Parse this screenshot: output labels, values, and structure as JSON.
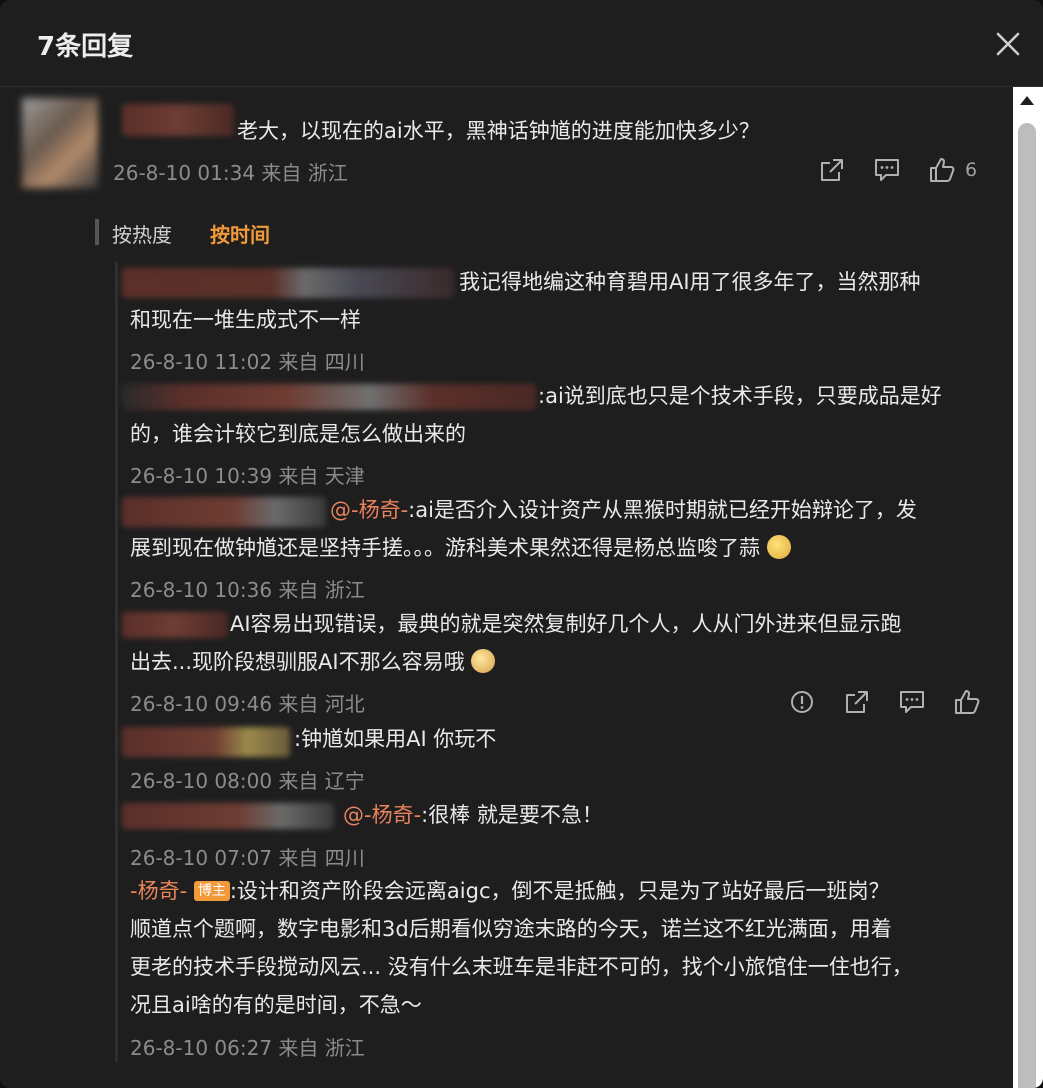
{
  "header": {
    "title": "7条回复"
  },
  "main_comment": {
    "text": "老大，以现在的ai水平，黑神话钟馗的进度能加快多少？",
    "time": "26-8-10 01:34",
    "location": "来自 浙江",
    "like_count": "6"
  },
  "sort": {
    "by_hot": "按热度",
    "by_time": "按时间"
  },
  "replies": [
    {
      "line1": "我记得地编这种育碧用AI用了很多年了，当然那种",
      "line2": "和现在一堆生成式不一样",
      "time": "26-8-10 11:02",
      "location": "来自 四川"
    },
    {
      "line1": ":ai说到底也只是个技术手段，只要成品是好",
      "line2": "的，谁会计较它到底是怎么做出来的",
      "time": "26-8-10 10:39",
      "location": "来自 天津"
    },
    {
      "mention": "@-杨奇-",
      "line1": ":ai是否介入设计资产从黑猴时期就已经开始辩论了，发",
      "line2": "展到现在做钟馗还是坚持手搓。。。游科美术果然还得是杨总监唆了蒜",
      "time": "26-8-10 10:36",
      "location": "来自 浙江"
    },
    {
      "line1": "AI容易出现错误，最典的就是突然复制好几个人，人从门外进来但显示跑",
      "line2": "出去...现阶段想驯服AI不那么容易哦",
      "time": "26-8-10 09:46",
      "location": "来自 河北"
    },
    {
      "line1": ":钟馗如果用AI 你玩不",
      "time": "26-8-10 08:00",
      "location": "来自 辽宁"
    },
    {
      "mention": "@-杨奇-",
      "line1": ":很棒 就是要不急！",
      "time": "26-8-10 07:07",
      "location": "来自 四川"
    },
    {
      "author": "-杨奇-",
      "badge": "博主",
      "line1": ":设计和资产阶段会远离aigc，倒不是抵触，只是为了站好最后一班岗？",
      "line2": "顺道点个题啊，数字电影和3d后期看似穷途末路的今天，诺兰这不红光满面，用着",
      "line3": "更老的技术手段搅动风云... 没有什么末班车是非赶不可的，找个小旅馆住一住也行，",
      "line4": "况且ai啥的有的是时间，不急～",
      "time": "26-8-10 06:27",
      "location": "来自 浙江"
    }
  ],
  "colors": {
    "accent": "#f29a3a",
    "mention": "#e8835c"
  }
}
